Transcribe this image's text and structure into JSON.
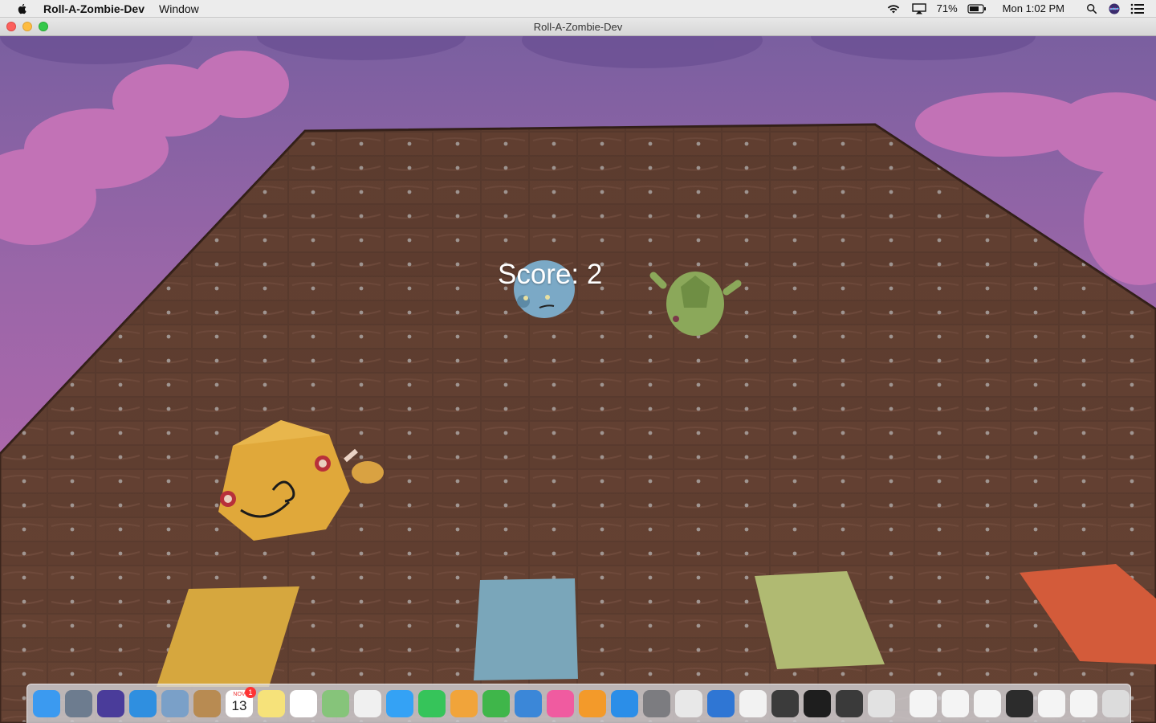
{
  "menubar": {
    "app_name": "Roll-A-Zombie-Dev",
    "menu_window": "Window",
    "battery": "71%",
    "clock": "Mon 1:02 PM",
    "icons": [
      "wifi-icon",
      "airplay-icon",
      "battery-icon",
      "spotlight-icon",
      "siri-icon",
      "notification-center-icon"
    ]
  },
  "window": {
    "title": "Roll-A-Zombie-Dev"
  },
  "game": {
    "score_text": "Score: 2",
    "pad_colors": [
      "#d6a73e",
      "#7aa6ba",
      "#b0ba72",
      "#d35b3a"
    ],
    "zombie_colors": {
      "yellow": "#e0a83a",
      "blue": "#7ba9c6",
      "green": "#8ba85a"
    }
  },
  "dock": {
    "items": [
      {
        "name": "finder-icon",
        "color": "#3b9af0"
      },
      {
        "name": "launchpad-icon",
        "color": "#6d7c8f"
      },
      {
        "name": "siri-icon",
        "color": "#4a3c9a"
      },
      {
        "name": "safari-icon",
        "color": "#2f8fe0"
      },
      {
        "name": "mail-preview-icon",
        "color": "#7aa0c8"
      },
      {
        "name": "contacts-icon",
        "color": "#b88b52"
      },
      {
        "name": "calendar-icon",
        "color": "#ffffff",
        "month": "NOV",
        "day": "13",
        "badge": "1"
      },
      {
        "name": "notes-icon",
        "color": "#f6e27a"
      },
      {
        "name": "reminders-icon",
        "color": "#ffffff"
      },
      {
        "name": "maps-icon",
        "color": "#86c47a"
      },
      {
        "name": "photos-icon",
        "color": "#f0f0f0"
      },
      {
        "name": "messages-icon",
        "color": "#34a2f5"
      },
      {
        "name": "facetime-icon",
        "color": "#36c45a"
      },
      {
        "name": "pages-icon",
        "color": "#f1a43a"
      },
      {
        "name": "numbers-icon",
        "color": "#3fb64a"
      },
      {
        "name": "keynote-icon",
        "color": "#3b87d8"
      },
      {
        "name": "itunes-icon",
        "color": "#f05ba0"
      },
      {
        "name": "ibooks-icon",
        "color": "#f39a2a"
      },
      {
        "name": "app-store-icon",
        "color": "#2b8ee8"
      },
      {
        "name": "system-preferences-icon",
        "color": "#7c7c80"
      },
      {
        "name": "chrome-icon",
        "color": "#e8e8e8"
      },
      {
        "name": "xcode-icon",
        "color": "#2f76d4"
      },
      {
        "name": "sublime-s-icon",
        "color": "#f2f2f2"
      },
      {
        "name": "sublime-text-icon",
        "color": "#3b3b3b"
      },
      {
        "name": "terminal-icon",
        "color": "#1e1e1e"
      },
      {
        "name": "unity-icon",
        "color": "#3a3a3a"
      },
      {
        "name": "preview-icon",
        "color": "#e2e2e2"
      }
    ],
    "minimized": [
      {
        "name": "minimized-window-1-icon",
        "color": "#f4f4f4"
      },
      {
        "name": "minimized-window-2-icon",
        "color": "#f4f4f4"
      },
      {
        "name": "minimized-window-3-icon",
        "color": "#f4f4f4"
      },
      {
        "name": "minimized-window-4-icon",
        "color": "#2c2c2c"
      },
      {
        "name": "minimized-window-5-icon",
        "color": "#f4f4f4"
      },
      {
        "name": "minimized-window-6-icon",
        "color": "#f4f4f4"
      },
      {
        "name": "trash-icon",
        "color": "#dcdcdc"
      }
    ]
  }
}
